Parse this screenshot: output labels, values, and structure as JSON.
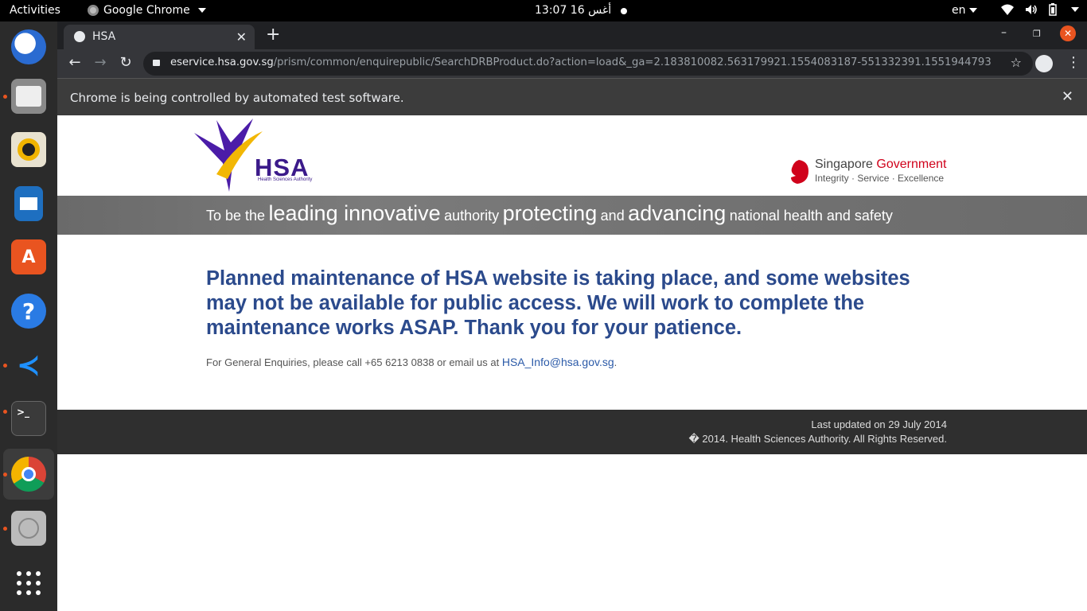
{
  "topbar": {
    "activities": "Activities",
    "app_name": "Google Chrome",
    "clock": "13:07  16 أغس",
    "lang": "en"
  },
  "dock": {
    "items": [
      "thunderbird",
      "files",
      "rhythmbox",
      "libreoffice-impress",
      "ubuntu-software",
      "help",
      "vscode",
      "terminal",
      "chrome",
      "dvd-drive",
      "show-applications"
    ]
  },
  "browser": {
    "tab_title": "HSA",
    "url_domain": "eservice.hsa.gov.sg",
    "url_path": "/prism/common/enquirepublic/SearchDRBProduct.do?action=load&_ga=2.183810082.563179921.1554083187-551332391.1551944793",
    "infobar_message": "Chrome is being controlled by automated test software."
  },
  "page": {
    "hsa_logo_text": "HSA",
    "hsa_logo_sub": "Health Sciences Authority",
    "sg_gov_line1_a": "Singapore",
    "sg_gov_line1_b": "Government",
    "sg_gov_line2": "Integrity · Service · Excellence",
    "tagline": {
      "w1": "To be the",
      "w2": "leading innovative",
      "w3": "authority",
      "w4": "protecting",
      "w5": "and",
      "w6": "advancing",
      "w7": "national health and safety"
    },
    "notice": "Planned maintenance of HSA website is taking place, and some websites may not be available for public access. We will work to complete the maintenance works ASAP. Thank you for your patience.",
    "enquiry_text": "For General Enquiries, please call +65 6213 0838 or email us at",
    "enquiry_email": "HSA_Info@hsa.gov.sg",
    "enquiry_end": ".",
    "footer_updated": "Last updated on 29 July 2014",
    "footer_copyright": "� 2014. Health Sciences Authority. All Rights Reserved."
  },
  "colors": {
    "notice": "#2b4a8c",
    "footer_bg": "#2f2f2f",
    "ubuntu_orange": "#e95420"
  }
}
